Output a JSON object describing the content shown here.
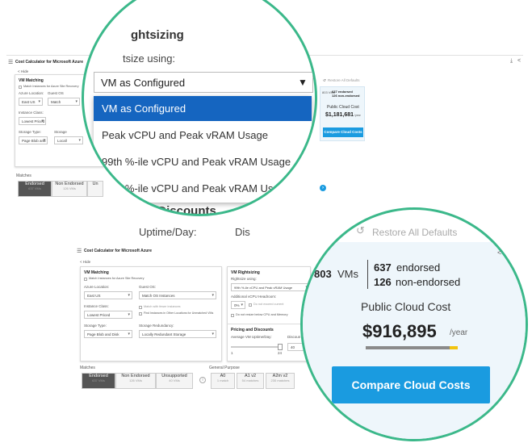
{
  "top_app": {
    "title": "Cost Calculator for Microsoft Azure",
    "hide": "< Hide",
    "vm_matching": "VM Matching",
    "match_srs": "Match Instances for Azure Site Recovery",
    "azure_location_label": "Azure Location:",
    "azure_location": "East US",
    "guest_os_label": "Guest OS",
    "guest_os": "Match",
    "instance_class_label": "Instance Class:",
    "instance_class": "Lowest Priced",
    "storage_type_label": "Storage Type:",
    "storage_type": "Page Blob and Disk",
    "storage_red_label": "Storage",
    "storage_red": "Locall",
    "matches_label": "Matches",
    "tab_endorsed": "Endorsed",
    "tab_endorsed_sub": "637 VMs",
    "tab_non_endorsed": "Non Endorsed",
    "tab_non_endorsed_sub": "126 VMs",
    "tab_un": "Un",
    "restore": "Restore All Defaults",
    "vms_count": "803 VMs",
    "endorsed": "637 endorsed",
    "non_endorsed": "126 non-endorsed",
    "cost_label": "Public Cloud Cost",
    "cost": "$1,181,681",
    "per": "/year",
    "compare": "Compare Cloud Costs"
  },
  "top_zoom": {
    "heading": "ghtsizing",
    "rightsize_label": "tsize using:",
    "selected": "VM as Configured",
    "options": [
      "VM as Configured",
      "Peak vCPU and Peak vRAM Usage",
      "99th %-ile vCPU and Peak vRAM Usage",
      "95th %-ile vCPU and Peak vRAM Usage"
    ],
    "pricing_heading": "ng and Discounts",
    "uptime_label": "Uptime/Day:",
    "disc_label": "Dis"
  },
  "bottom_app": {
    "title": "Cost Calculator for Microsoft Azure",
    "hide": "< Hide",
    "vm_matching": "VM Matching",
    "match_srs": "Match Instances for Azure Site Recovery",
    "azure_location_label": "Azure Location:",
    "azure_location": "East US",
    "guest_os_label": "Guest OS:",
    "guest_os": "Match OS Instances",
    "instance_class_label": "Instance Class:",
    "instance_class": "Lowest Priced",
    "match_with_fewer": "Match with fewer instances",
    "find_other": "Find Instances in Other Locations for Unmatched VMs",
    "storage_type_label": "Storage Type:",
    "storage_type": "Page Blob and Disk",
    "storage_red_label": "Storage Redundancy:",
    "storage_red": "Locally Redundant Storage",
    "rightsizing": "VM Rightsizing",
    "rightsize_using": "Rightsize using:",
    "rightsize_value": "99th %-ile vCPU and Peak vRAM Usage",
    "headroom_label": "Additional vCPU Headroom:",
    "headroom_value": "0%",
    "no_reduce": "Do not exceed current",
    "no_below": "Do not resize below CPU and Memory",
    "pricing": "Pricing and Discounts",
    "uptime_label": "Average VM Uptime/Day:",
    "discount_label": "Discoun",
    "uptime_min": "1",
    "uptime_max": "24",
    "discount_val": "40",
    "matches_label": "Matches",
    "tab_endorsed": "Endorsed",
    "tab_endorsed_sub": "637 VMs",
    "tab_non_endorsed": "Non Endorsed",
    "tab_non_endorsed_sub": "126 VMs",
    "tab_unsupported": "Unsupported",
    "tab_unsupported_sub": "40 VMs",
    "general_purpose": "General Purpose",
    "cols": [
      {
        "name": "A0",
        "sub": "1 match"
      },
      {
        "name": "A1 v2",
        "sub": "54 matches"
      },
      {
        "name": "A2m v2",
        "sub": "230 matches"
      }
    ]
  },
  "bottom_zoom": {
    "restore": "Restore All Defaults",
    "vms_count": "803",
    "vms_unit": "VMs",
    "endorsed_num": "637",
    "endorsed_word": "endorsed",
    "non_endorsed_num": "126",
    "non_endorsed_word": "non-endorsed",
    "cost_label": "Public Cloud Cost",
    "cost": "$916,895",
    "per": "/year",
    "compare": "Compare Cloud Costs"
  },
  "colors": {
    "accent": "#1a9be0",
    "highlight": "#1565c0",
    "circle": "#3bb88a",
    "bar_grey": "#8a8a8a",
    "bar_yellow": "#f2c40f"
  }
}
